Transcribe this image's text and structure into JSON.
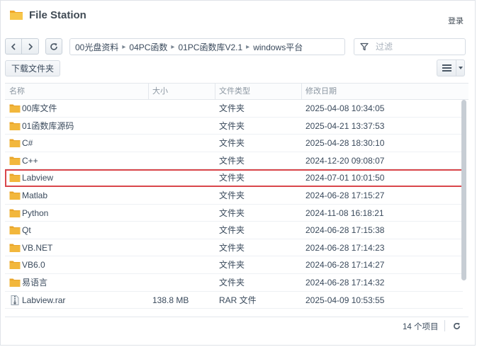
{
  "app": {
    "title": "File Station",
    "login_label": "登录"
  },
  "toolbar": {
    "breadcrumb": [
      "00光盘资料",
      "04PC函数",
      "01PC函数库V2.1",
      "windows平台"
    ],
    "filter_placeholder": "过滤",
    "download_label": "下载文件夹"
  },
  "table": {
    "columns": [
      "名称",
      "大小",
      "文件类型",
      "修改日期"
    ],
    "rows": [
      {
        "icon": "folder-icon",
        "name": "00库文件",
        "size": "",
        "type": "文件夹",
        "modified": "2025-04-08 10:34:05"
      },
      {
        "icon": "folder-icon",
        "name": "01函数库源码",
        "size": "",
        "type": "文件夹",
        "modified": "2025-04-21 13:37:53"
      },
      {
        "icon": "folder-icon",
        "name": "C#",
        "size": "",
        "type": "文件夹",
        "modified": "2025-04-28 18:30:10"
      },
      {
        "icon": "folder-icon",
        "name": "C++",
        "size": "",
        "type": "文件夹",
        "modified": "2024-12-20 09:08:07"
      },
      {
        "icon": "folder-icon",
        "name": "Labview",
        "size": "",
        "type": "文件夹",
        "modified": "2024-07-01 10:01:50",
        "highlighted": true
      },
      {
        "icon": "folder-icon",
        "name": "Matlab",
        "size": "",
        "type": "文件夹",
        "modified": "2024-06-28 17:15:27"
      },
      {
        "icon": "folder-icon",
        "name": "Python",
        "size": "",
        "type": "文件夹",
        "modified": "2024-11-08 16:18:21"
      },
      {
        "icon": "folder-icon",
        "name": "Qt",
        "size": "",
        "type": "文件夹",
        "modified": "2024-06-28 17:15:38"
      },
      {
        "icon": "folder-icon",
        "name": "VB.NET",
        "size": "",
        "type": "文件夹",
        "modified": "2024-06-28 17:14:23"
      },
      {
        "icon": "folder-icon",
        "name": "VB6.0",
        "size": "",
        "type": "文件夹",
        "modified": "2024-06-28 17:14:27"
      },
      {
        "icon": "folder-icon",
        "name": "易语言",
        "size": "",
        "type": "文件夹",
        "modified": "2024-06-28 17:14:32"
      },
      {
        "icon": "archive-file-icon",
        "name": "Labview.rar",
        "size": "138.8 MB",
        "type": "RAR 文件",
        "modified": "2025-04-09 10:53:55"
      }
    ]
  },
  "footer": {
    "item_count": "14 个项目"
  },
  "colors": {
    "folder": "#f2b73c",
    "highlight_border": "#d9464b",
    "scrollbar": "#c7cdd4"
  }
}
